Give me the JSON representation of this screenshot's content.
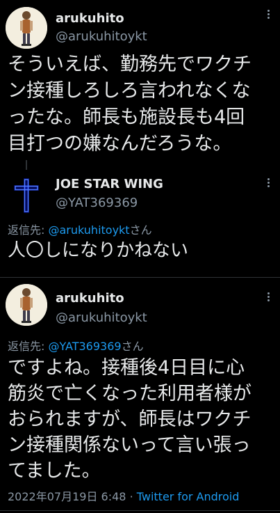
{
  "tweets": [
    {
      "name": "arukuhito",
      "handle": "@arukuhitoykt",
      "lines": [
        "そういえば、勤務先でワクチ",
        "ン接種しろしろ言われなくな",
        "ったな。師長も施設長も4回",
        "目打つの嫌なんだろうな。"
      ]
    },
    {
      "name": "JOE STAR WING",
      "handle": "@YAT369369",
      "reply_prefix": "返信先: ",
      "reply_to": "@arukuhitoykt",
      "reply_suffix": "さん",
      "lines": [
        "人〇しになりかねない"
      ]
    },
    {
      "name": "arukuhito",
      "handle": "@arukuhitoykt",
      "reply_prefix": "返信先: ",
      "reply_to": "@YAT369369",
      "reply_suffix": "さん",
      "lines": [
        "ですよね。接種後4日目に心",
        "筋炎で亡くなった利用者様が",
        "おられますが、師長はワクチ",
        "ン接種関係ないって言い張っ",
        "てました。"
      ],
      "timestamp": "2022年07月19日 6:48",
      "separator": "·",
      "source": "Twitter for Android"
    }
  ],
  "colors": {
    "background": "#000000",
    "text": "#e7e9ea",
    "secondary": "#8b98a5",
    "link": "#1d9bf0",
    "cross_glow": "#1e4dff"
  },
  "icons": [
    "more-options-icon",
    "cross-avatar"
  ]
}
